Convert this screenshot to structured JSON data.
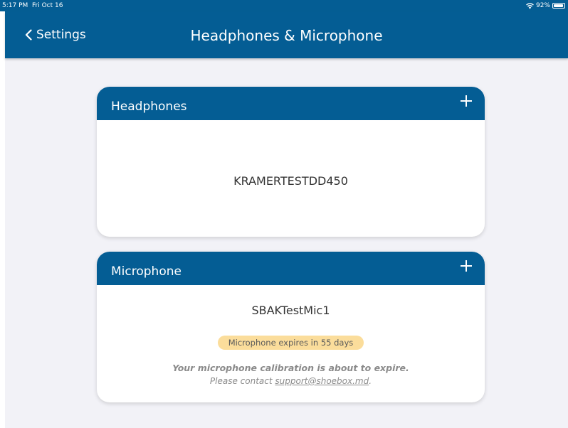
{
  "status_bar": {
    "time": "5:17 PM",
    "date": "Fri Oct 16",
    "battery_percent": "92%",
    "battery_level": 0.92
  },
  "nav": {
    "back_label": "Settings",
    "title": "Headphones & Microphone"
  },
  "headphones_card": {
    "title": "Headphones",
    "device_name": "KRAMERTESTDD450"
  },
  "microphone_card": {
    "title": "Microphone",
    "device_name": "SBAKTestMic1",
    "expiry_badge": "Microphone expires in 55 days",
    "warning_title": "Your microphone calibration is about to expire.",
    "warning_prefix": "Please contact ",
    "support_email": "support@shoebox.md",
    "warning_suffix": "."
  },
  "colors": {
    "primary": "#045d94",
    "background": "#f2f2f7",
    "badge": "#fbdd9b",
    "muted_text": "#8a8a8a"
  },
  "icons": {
    "back": "chevron-left-icon",
    "add": "plus-icon",
    "wifi": "wifi-icon",
    "battery": "battery-icon"
  }
}
